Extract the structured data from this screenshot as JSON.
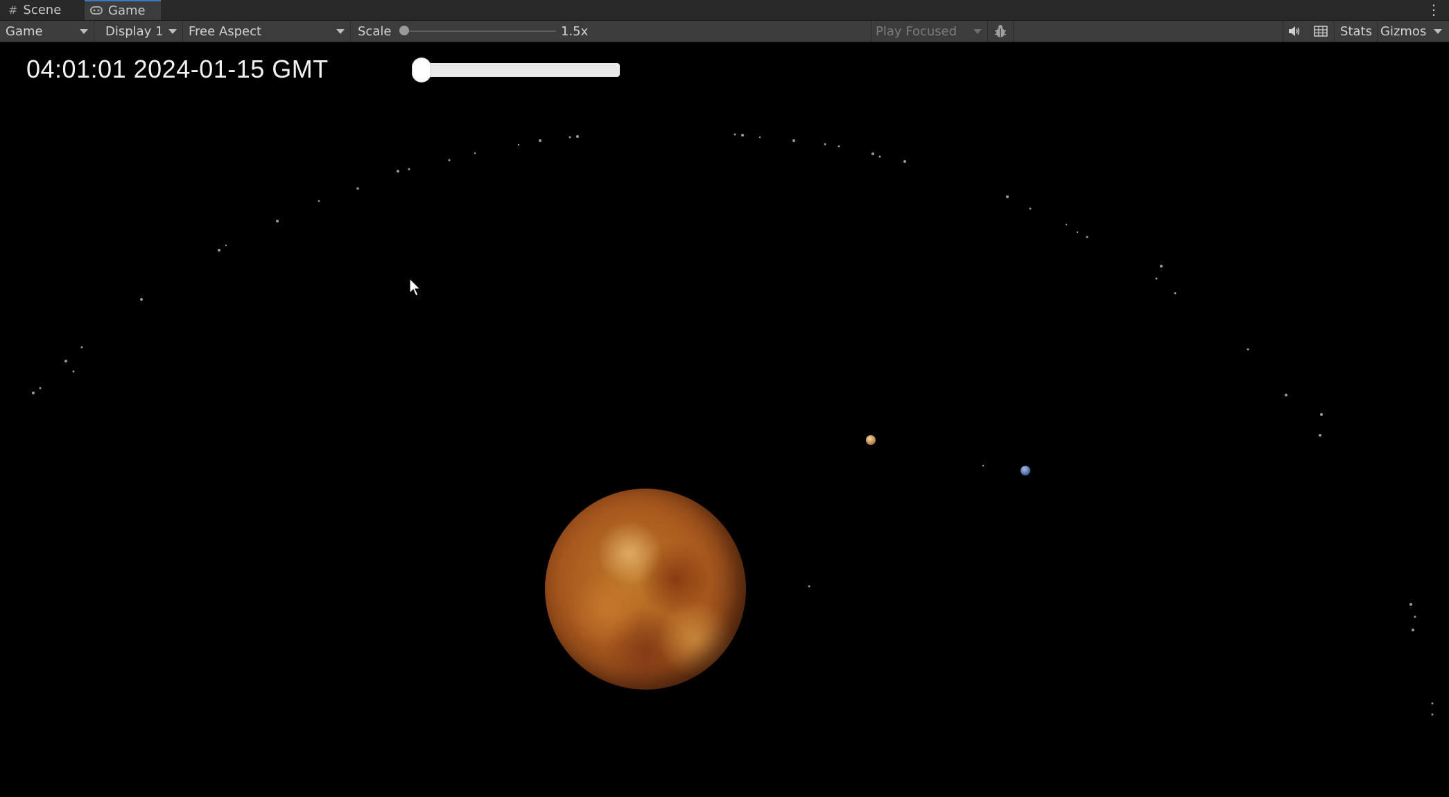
{
  "tabs": [
    {
      "label": "Scene",
      "icon": "hash-icon"
    },
    {
      "label": "Game",
      "icon": "gamepad-icon"
    }
  ],
  "toolbar": {
    "view_mode": "Game",
    "display": "Display 1",
    "aspect": "Free Aspect",
    "scale_label": "Scale",
    "scale_value": "1.5x",
    "play_focused": "Play Focused",
    "stats": "Stats",
    "gizmos": "Gizmos"
  },
  "hud": {
    "clock": "04:01:01 2024-01-15 GMT",
    "time_slider_fraction": 0.0
  },
  "colors": {
    "accent_tab": "#3a79bb",
    "background": "#000000",
    "toolbar_bg": "#3c3c3c"
  }
}
